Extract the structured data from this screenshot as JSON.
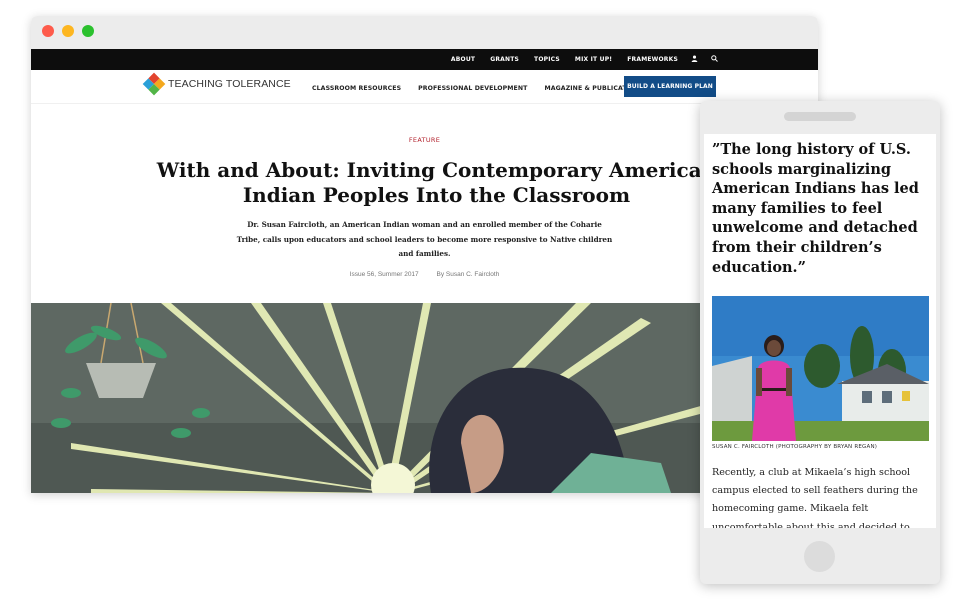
{
  "window_controls": [
    "close",
    "minimize",
    "maximize"
  ],
  "utility_nav": {
    "items": [
      "ABOUT",
      "GRANTS",
      "TOPICS",
      "MIX IT UP!",
      "FRAMEWORKS"
    ],
    "icons": [
      "user-icon",
      "search-icon"
    ]
  },
  "brand": {
    "name": "TEACHING TOLERANCE",
    "colors": [
      "#e2442f",
      "#f4a81d",
      "#2aa0d8",
      "#52b547"
    ]
  },
  "main_nav": {
    "items": [
      "CLASSROOM RESOURCES",
      "PROFESSIONAL DEVELOPMENT",
      "MAGAZINE & PUBLICATIONS"
    ],
    "cta": "BUILD A LEARNING PLAN",
    "cta_color": "#124c87"
  },
  "article": {
    "eyebrow": "FEATURE",
    "title": "With and About: Inviting Contemporary American Indian Peoples Into the Classroom",
    "dek": "Dr. Susan Faircloth, an American Indian woman and an enrolled member of the Coharie Tribe, calls upon educators and school leaders to become more responsive to Native children and families.",
    "issue": "Issue 56, Summer 2017",
    "byline": "By Susan C. Faircloth"
  },
  "mobile": {
    "pull_quote": "”The long history of U.S. schools marginalizing American Indians has led many families to feel unwelcome and detached from their children’s education.”",
    "photo_caption": "SUSAN C. FAIRCLOTH (PHOTOGRAPHY BY BRYAN REGAN)",
    "body": "Recently, a club at Mikaela’s high school campus elected to sell feathers during the homecoming game. Mikaela felt uncomfortable about this and decided to confront the issue. It"
  },
  "colors": {
    "accent_red": "#b3242f",
    "utility_bar": "#0d0d0d"
  }
}
